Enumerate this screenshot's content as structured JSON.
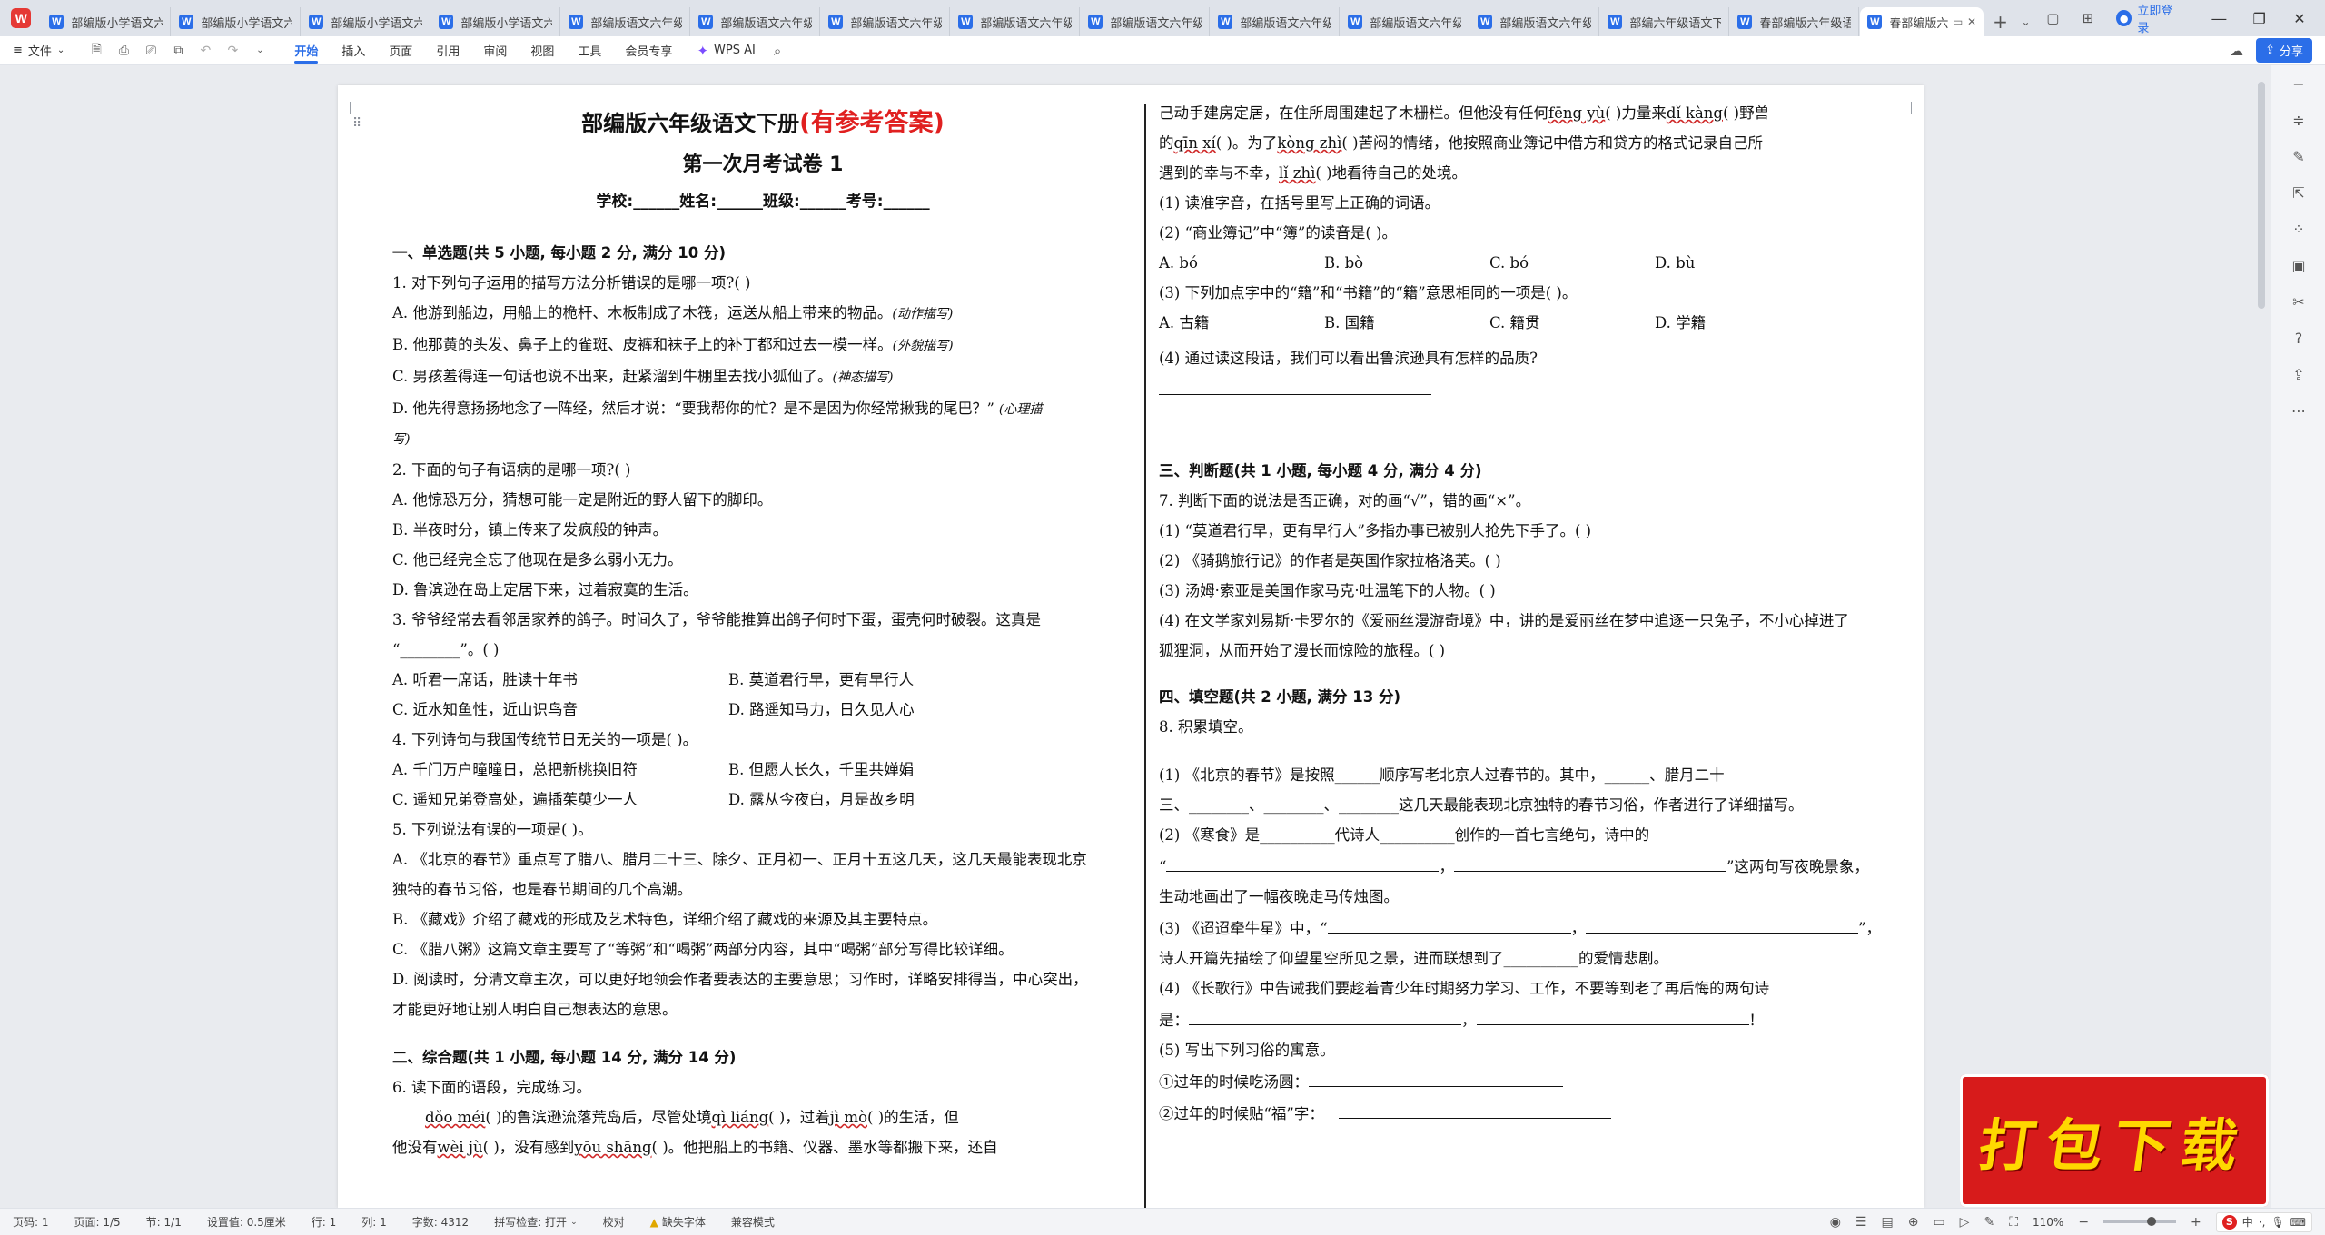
{
  "tabs": {
    "items": [
      {
        "label": "部编版小学语文六"
      },
      {
        "label": "部编版小学语文六"
      },
      {
        "label": "部编版小学语文六"
      },
      {
        "label": "部编版小学语文六"
      },
      {
        "label": "部编版语文六年级"
      },
      {
        "label": "部编版语文六年级"
      },
      {
        "label": "部编版语文六年级"
      },
      {
        "label": "部编版语文六年级"
      },
      {
        "label": "部编版语文六年级"
      },
      {
        "label": "部编版语文六年级"
      },
      {
        "label": "部编版语文六年级"
      },
      {
        "label": "部编版语文六年级"
      },
      {
        "label": "部编六年级语文下"
      },
      {
        "label": "春部编版六年级语"
      }
    ],
    "active": {
      "label": "春部编版六"
    },
    "login": "立即登录"
  },
  "menu": {
    "file": "文件",
    "tabs": [
      "开始",
      "插入",
      "页面",
      "引用",
      "审阅",
      "视图",
      "工具",
      "会员专享"
    ],
    "wps_ai": "WPS AI",
    "share": "分享"
  },
  "doc": {
    "title_main": "部编版六年级语文下册",
    "title_red": "(有参考答案)",
    "title_sub": "第一次月考试卷 1",
    "info": "学校:______姓名:______班级:______考号:______",
    "s1": "一、单选题(共 5 小题, 每小题 2 分, 满分 10 分)",
    "q1": "1. 对下列句子运用的描写方法分析错误的是哪一项?(        )",
    "q1a": "A. 他游到船边，用船上的桅杆、木板制成了木筏，运送从船上带来的物品。",
    "q1a_n": "(动作描写)",
    "q1b": "B. 他那黄的头发、鼻子上的雀斑、皮裤和袜子上的补丁都和过去一模一样。",
    "q1b_n": "(外貌描写)",
    "q1c": "C. 男孩羞得连一句话也说不出来，赶紧溜到牛棚里去找小狐仙了。",
    "q1c_n": "(神态描写)",
    "q1d": "D. 他先得意扬扬地念了一阵经，然后才说：“要我帮你的忙？是不是因为你经常揪我的尾巴？”",
    "q1d_n1": "(心理描",
    "q1d_n2": "写)",
    "q2": "2. 下面的句子有语病的是哪一项?(          )",
    "q2a": "A. 他惊恐万分，猜想可能一定是附近的野人留下的脚印。",
    "q2b": "B. 半夜时分，镇上传来了发疯般的钟声。",
    "q2c": "C. 他已经完全忘了他现在是多么弱小无力。",
    "q2d": "D. 鲁滨逊在岛上定居下来，过着寂寞的生活。",
    "q3": "3. 爷爷经常去看邻居家养的鸽子。时间久了，爷爷能推算出鸽子何时下蛋，蛋壳何时破裂。这真是",
    "q3b": "“________”。(          )",
    "q3a": "A. 听君一席话，胜读十年书",
    "q3bb": "B. 莫道君行早，更有早行人",
    "q3c": "C. 近水知鱼性，近山识鸟音",
    "q3d": "D. 路遥知马力，日久见人心",
    "q4": "4. 下列诗句与我国传统节日无关的一项是(          )。",
    "q4a": "A. 千门万户曈曈日，总把新桃换旧符",
    "q4b": "B. 但愿人长久，千里共婵娟",
    "q4c": "C. 遥知兄弟登高处，遍插茱萸少一人",
    "q4d": "D. 露从今夜白，月是故乡明",
    "q5": "5. 下列说法有误的一项是(          )。",
    "q5a1": "A. 《北京的春节》重点写了腊八、腊月二十三、除夕、正月初一、正月十五这几天，这几天最能表现北京",
    "q5a2": "独特的春节习俗，也是春节期间的几个高潮。",
    "q5b": "B. 《藏戏》介绍了藏戏的形成及艺术特色，详细介绍了藏戏的来源及其主要特点。",
    "q5c": "C. 《腊八粥》这篇文章主要写了“等粥”和“喝粥”两部分内容，其中“喝粥”部分写得比较详细。",
    "q5d1": "D. 阅读时，分清文章主次，可以更好地领会作者要表达的主要意思；习作时，详略安排得当，中心突出，",
    "q5d2": "才能更好地让别人明白自己想表达的意思。",
    "s2": "二、综合题(共 1 小题, 每小题 14 分, 满分 14 分)",
    "q6": "6. 读下面的语段，完成练习。",
    "q6p1a": "dǒo méi",
    "q6p1b": "(        )的鲁滨逊流落荒岛后，尽管处境",
    "q6p1c": "qì liáng",
    "q6p1d": "(        )，过着",
    "q6p1e": "jì mò",
    "q6p1f": "(        )的生活，但",
    "q6p2a": "他没有",
    "q6p2b": "wèi jù",
    "q6p2c": "(        )，没有感到",
    "q6p2d": "yōu shāng",
    "q6p2e": "(        )。他把船上的书籍、仪器、墨水等都搬下来，还自",
    "r1a": "己动手建房定居，在住所周围建起了木栅栏。但他没有任何",
    "r1b": "fēng yù",
    "r1c": "(        )力量来",
    "r1d": "dǐ kàng",
    "r1e": "(        )野兽",
    "r2a": "的",
    "r2b": "qīn xí",
    "r2c": "(        )。为了",
    "r2d": "kòng zhì",
    "r2e": "(        )苦闷的情绪，他按照商业簿记中借方和贷方的格式记录自己所",
    "r3a": "遇到的幸与不幸，",
    "r3b": "lǐ zhì",
    "r3c": "(        )地看待自己的处境。",
    "r4": "(1) 读准字音，在括号里写上正确的词语。",
    "r5": "(2) “商业簿记”中“簿”的读音是(          )。",
    "r6": [
      "A. bó",
      "B. bò",
      "C. bó",
      "D. bù"
    ],
    "r7": "(3) 下列加点字中的“籍”和“书籍”的“籍”意思相同的一项是(          )。",
    "r8": [
      "A. 古籍",
      "B. 国籍",
      "C. 籍贯",
      "D. 学籍"
    ],
    "r9": "(4) 通过读这段话，我们可以看出鲁滨逊具有怎样的品质?",
    "s3": "三、判断题(共 1 小题, 每小题 4 分, 满分 4 分)",
    "q7": "7. 判断下面的说法是否正确，对的画“√”，错的画“×”。",
    "q7a": "(1) “莫道君行早，更有早行人”多指办事已被别人抢先下手了。(          )",
    "q7b": "(2) 《骑鹅旅行记》的作者是英国作家拉格洛芙。(          )",
    "q7c": "(3) 汤姆·索亚是美国作家马克·吐温笔下的人物。(          )",
    "q7d1": "(4) 在文学家刘易斯·卡罗尔的《爱丽丝漫游奇境》中，讲的是爱丽丝在梦中追逐一只兔子，不小心掉进了",
    "q7d2": "狐狸洞，从而开始了漫长而惊险的旅程。(          )",
    "s4": "四、填空题(共 2 小题, 满分 13 分)",
    "q8": "8. 积累填空。",
    "q8a1": "(1) 《北京的春节》是按照______顺序写老北京人过春节的。其中，______、腊月二十",
    "q8a2": "三、________、________、________这几天最能表现北京独特的春节习俗，作者进行了详细描写。",
    "q8b1": "(2) 《寒食》是__________代诗人__________创作的一首七言绝句，诗中的",
    "q8b2a": "“",
    "q8b2b": "，",
    "q8b2c": "”这两句写夜晚景象，",
    "q8b3": "生动地画出了一幅夜晚走马传烛图。",
    "q8c1a": "(3) 《迢迢牵牛星》中，“",
    "q8c1b": "，",
    "q8c1c": "”，",
    "q8c2": "诗人开篇先描绘了仰望星空所见之景，进而联想到了__________的爱情悲剧。",
    "q8d1": "(4) 《长歌行》中告诫我们要趁着青少年时期努力学习、工作，不要等到老了再后悔的两句诗",
    "q8d2a": "是：",
    "q8d2b": "，",
    "q8d2c": "！",
    "q8e": "(5) 写出下列习俗的寓意。",
    "q8e1": "①过年的时候吃汤圆：",
    "q8e2": "②过年的时候贴“福”字："
  },
  "badge": "打包下载",
  "status": {
    "page_no": "页码: 1",
    "pages": "页面: 1/5",
    "section": "节: 1/1",
    "setting": "设置值: 0.5厘米",
    "row": "行: 1",
    "col": "列: 1",
    "words": "字数: 4312",
    "spell": "拼写检查: 打开",
    "proof": "校对",
    "missing_font": "缺失字体",
    "compat": "兼容模式",
    "zoom": "110%",
    "ime_lang": "中"
  },
  "colors": {
    "accent": "#2b6ee8",
    "title_red": "#e02020",
    "badge_bg": "#d71b1b",
    "badge_text": "#ffd800"
  },
  "icons": [
    "wps-logo-icon",
    "word-doc-icon",
    "close-icon",
    "add-tab-icon",
    "user-icon",
    "minimize-icon",
    "maximize-icon",
    "window-close-icon",
    "save-icon",
    "print-icon",
    "undo-icon",
    "redo-icon",
    "search-icon",
    "share-icon",
    "star-ai-icon"
  ]
}
